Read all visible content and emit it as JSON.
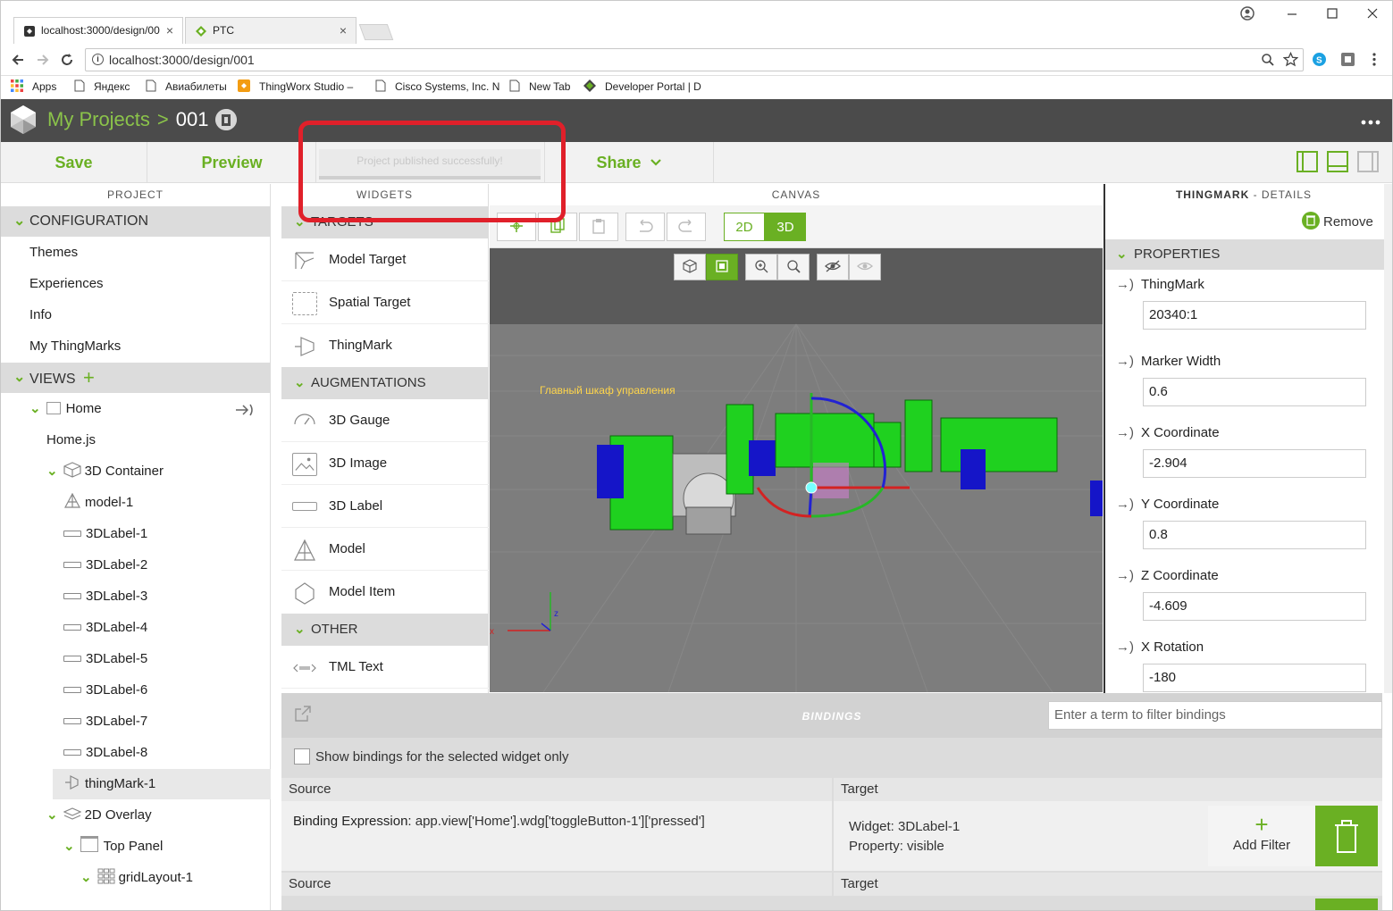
{
  "browser": {
    "tabs": [
      {
        "label": "localhost:3000/design/00",
        "close": "×"
      },
      {
        "label": "PTC",
        "close": "×"
      }
    ],
    "url": "localhost:3000/design/001",
    "bookmarks": [
      {
        "label": "Apps"
      },
      {
        "label": "Яндекс"
      },
      {
        "label": "Авиабилеты"
      },
      {
        "label": "ThingWorx Studio –"
      },
      {
        "label": "Cisco Systems, Inc. N"
      },
      {
        "label": "New Tab"
      },
      {
        "label": "Developer Portal | D"
      }
    ]
  },
  "header": {
    "breadcrumb_root": "My Projects",
    "separator": ">",
    "project_name": "001"
  },
  "toolbar": {
    "save_label": "Save",
    "preview_label": "Preview",
    "status_message": "Project published successfully!",
    "share_label": "Share"
  },
  "project_panel": {
    "title": "PROJECT",
    "configuration": {
      "label": "CONFIGURATION",
      "items": [
        "Themes",
        "Experiences",
        "Info",
        "My ThingMarks"
      ]
    },
    "views": {
      "label": "VIEWS",
      "tree": [
        {
          "label": "Home"
        },
        {
          "label": "Home.js"
        },
        {
          "label": "3D Container"
        },
        {
          "label": "model-1"
        },
        {
          "label": "3DLabel-1"
        },
        {
          "label": "3DLabel-2"
        },
        {
          "label": "3DLabel-3"
        },
        {
          "label": "3DLabel-4"
        },
        {
          "label": "3DLabel-5"
        },
        {
          "label": "3DLabel-6"
        },
        {
          "label": "3DLabel-7"
        },
        {
          "label": "3DLabel-8"
        },
        {
          "label": "thingMark-1"
        },
        {
          "label": "2D Overlay"
        },
        {
          "label": "Top Panel"
        },
        {
          "label": "gridLayout-1"
        }
      ]
    }
  },
  "widgets_panel": {
    "title": "WIDGETS",
    "targets_label": "TARGETS",
    "targets": [
      "Model Target",
      "Spatial Target",
      "ThingMark"
    ],
    "augmentations_label": "AUGMENTATIONS",
    "augmentations": [
      "3D Gauge",
      "3D Image",
      "3D Label",
      "Model",
      "Model Item"
    ],
    "other_label": "OTHER",
    "other": [
      "TML Text"
    ]
  },
  "canvas": {
    "title": "CANVAS",
    "mode_2d": "2D",
    "mode_3d": "3D",
    "scene_label_main": "Главный шкаф управления"
  },
  "details": {
    "title_strong": "THINGMARK",
    "title_rest": " - DETAILS",
    "remove_label": "Remove",
    "properties_label": "PROPERTIES",
    "props": [
      {
        "label": "ThingMark",
        "value": "20340:1"
      },
      {
        "label": "Marker Width",
        "value": "0.6"
      },
      {
        "label": "X Coordinate",
        "value": "-2.904"
      },
      {
        "label": "Y Coordinate",
        "value": "0.8"
      },
      {
        "label": "Z Coordinate",
        "value": "-4.609"
      },
      {
        "label": "X Rotation",
        "value": "-180"
      }
    ]
  },
  "bindings": {
    "title": "BINDINGS",
    "filter_placeholder": "Enter a term to filter bindings",
    "show_selected_label": "Show bindings for the selected widget only",
    "source_label": "Source",
    "target_label": "Target",
    "row1": {
      "expr_label": "Binding Expression:",
      "expr_value": "app.view['Home'].wdg['toggleButton-1']['pressed']",
      "widget_label": "Widget:",
      "widget_value": "3DLabel-1",
      "property_label": "Property:",
      "property_value": "visible"
    },
    "add_filter_label": "Add Filter"
  },
  "colors": {
    "accent": "#6ab023",
    "header_bg": "#4b4b4b",
    "highlight": "#e0202a"
  }
}
